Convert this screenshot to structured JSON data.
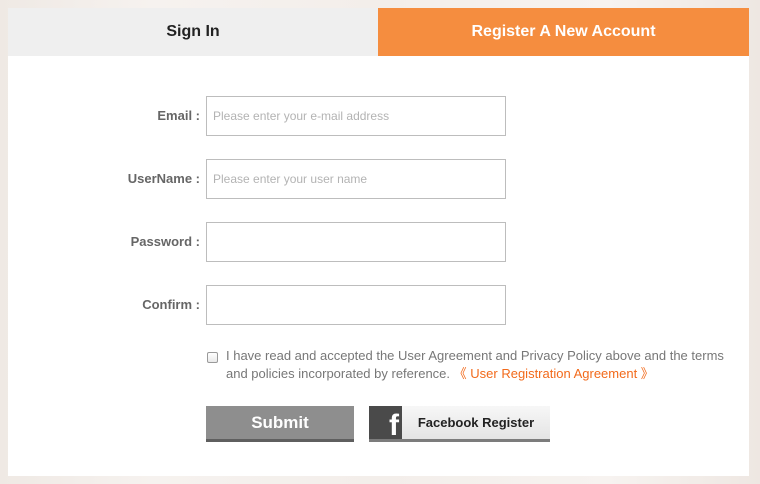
{
  "tabs": {
    "signin": "Sign In",
    "register": "Register A New Account"
  },
  "form": {
    "email": {
      "label": "Email :",
      "placeholder": "Please enter your e-mail address",
      "value": ""
    },
    "username": {
      "label": "UserName :",
      "placeholder": "Please enter your user name",
      "value": ""
    },
    "password": {
      "label": "Password :",
      "placeholder": "",
      "value": ""
    },
    "confirm": {
      "label": "Confirm :",
      "placeholder": "",
      "value": ""
    }
  },
  "agreement": {
    "checked": false,
    "text": "I have read and accepted the User Agreement and Privacy Policy above and the terms and policies incorporated by reference.",
    "link": "《 User Registration Agreement 》"
  },
  "buttons": {
    "submit": "Submit",
    "facebook_icon": "f",
    "facebook": "Facebook Register"
  },
  "colors": {
    "accent": "#f58d3f",
    "link": "#f26a1b",
    "submit": "#8e8e8e"
  },
  "icons": {
    "facebook": "facebook-icon"
  }
}
